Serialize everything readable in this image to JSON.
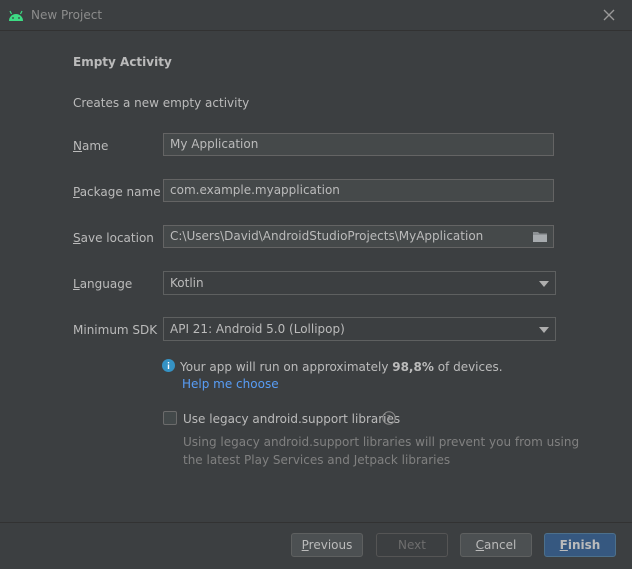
{
  "window": {
    "title": "New Project"
  },
  "heading": "Empty Activity",
  "subheading": "Creates a new empty activity",
  "form": {
    "name": {
      "label": "Name",
      "value": "My Application"
    },
    "package": {
      "label": "Package name",
      "value": "com.example.myapplication"
    },
    "location": {
      "label": "Save location",
      "value": "C:\\Users\\David\\AndroidStudioProjects\\MyApplication"
    },
    "language": {
      "label": "Language",
      "value": "Kotlin"
    },
    "min_sdk": {
      "label": "Minimum SDK",
      "value": "API 21: Android 5.0 (Lollipop)"
    }
  },
  "info": {
    "prefix": "Your app will run on approximately ",
    "percent": "98,8%",
    "suffix": " of devices.",
    "help_link": "Help me choose"
  },
  "legacy": {
    "label": "Use legacy android.support libraries",
    "checked": false,
    "desc_line1": "Using legacy android.support libraries will prevent you from using",
    "desc_line2": "the latest Play Services and Jetpack libraries"
  },
  "buttons": {
    "previous": "Previous",
    "next": "Next",
    "cancel": "Cancel",
    "finish": "Finish"
  },
  "colors": {
    "accent": "#365880",
    "link": "#589df6",
    "android_green": "#3ddc84"
  }
}
